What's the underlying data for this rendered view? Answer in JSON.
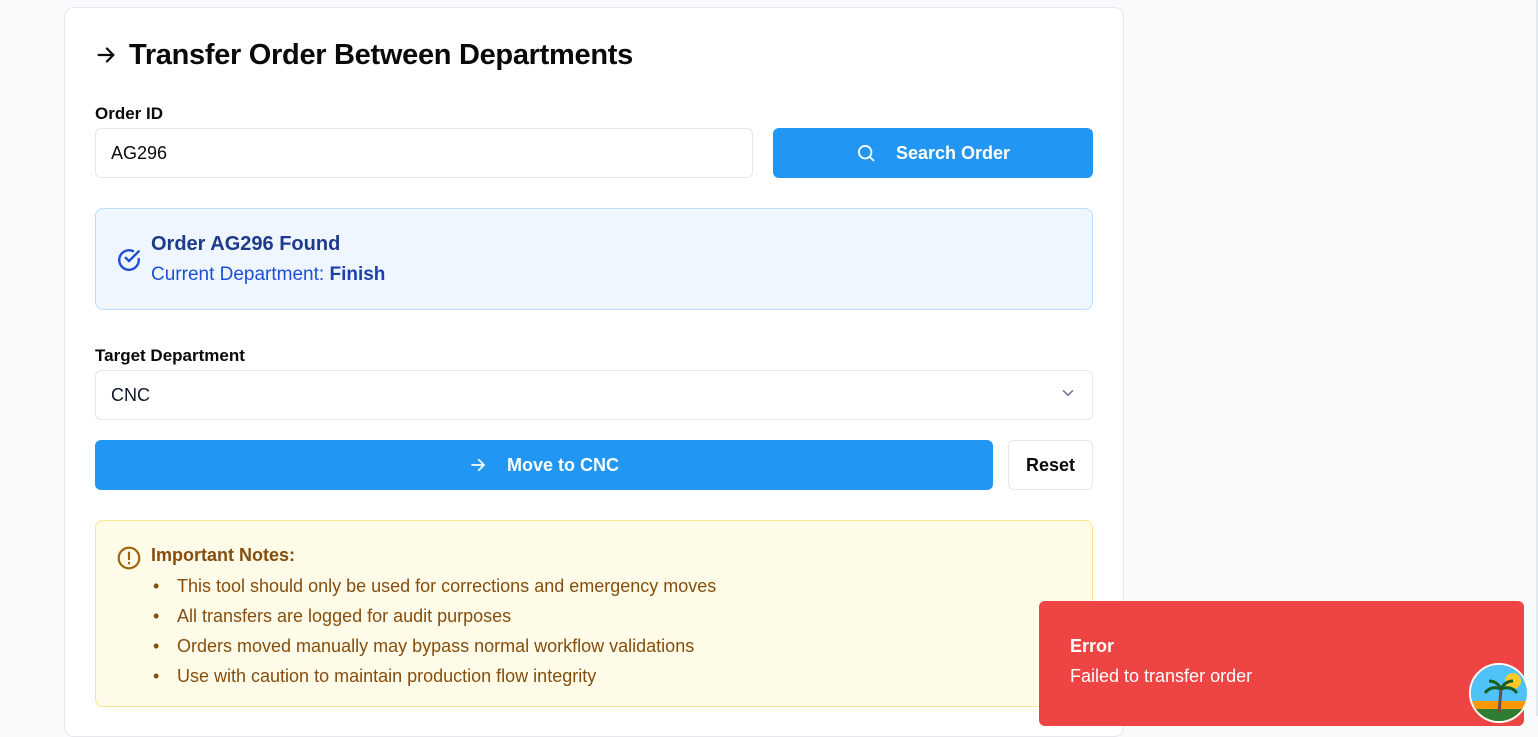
{
  "page": {
    "title": "Transfer Order Between Departments"
  },
  "order_search": {
    "label": "Order ID",
    "value": "AG296",
    "button_label": "Search Order"
  },
  "found": {
    "title": "Order AG296 Found",
    "department_prefix": "Current Department:",
    "department_value": "Finish"
  },
  "target": {
    "label": "Target Department",
    "selected": "CNC"
  },
  "actions": {
    "move_label": "Move to CNC",
    "reset_label": "Reset"
  },
  "notes": {
    "title": "Important Notes:",
    "items": [
      "This tool should only be used for corrections and emergency moves",
      "All transfers are logged for audit purposes",
      "Orders moved manually may bypass normal workflow validations",
      "Use with caution to maintain production flow integrity"
    ]
  },
  "toast": {
    "title": "Error",
    "message": "Failed to transfer order"
  },
  "colors": {
    "primary": "#2196f3",
    "info_bg": "#eff6ff",
    "warning_bg": "#fefce8",
    "error": "#ef4444"
  },
  "icons": {
    "title": "arrow-right-icon",
    "search": "search-icon",
    "found": "check-circle-icon",
    "select": "chevron-down-icon",
    "move": "arrow-right-icon",
    "notes": "alert-circle-icon"
  }
}
